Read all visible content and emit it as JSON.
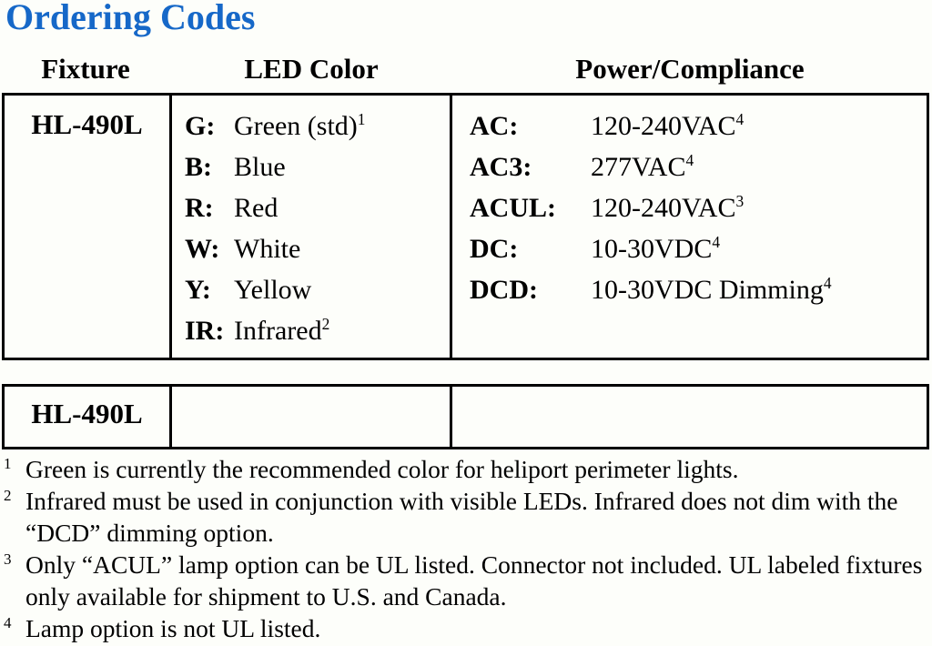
{
  "title": "Ordering Codes",
  "accent_color": "#1668c8",
  "background_color": "#fdfefa",
  "headers": {
    "fixture": "Fixture",
    "led_color": "LED Color",
    "power_compliance": "Power/Compliance"
  },
  "main_table": {
    "fixture": "HL-490L",
    "led_colors": [
      {
        "code": "G:",
        "value": "Green (std)",
        "footnote": "1"
      },
      {
        "code": "B:",
        "value": "Blue",
        "footnote": ""
      },
      {
        "code": "R:",
        "value": "Red",
        "footnote": ""
      },
      {
        "code": "W:",
        "value": "White",
        "footnote": ""
      },
      {
        "code": "Y:",
        "value": "Yellow",
        "footnote": ""
      },
      {
        "code": "IR:",
        "value": "Infrared",
        "footnote": "2"
      }
    ],
    "power_options": [
      {
        "code": "AC:",
        "value": "120-240VAC",
        "footnote": "4"
      },
      {
        "code": "AC3:",
        "value": "277VAC",
        "footnote": "4"
      },
      {
        "code": "ACUL:",
        "value": "120-240VAC",
        "footnote": "3"
      },
      {
        "code": "DC:",
        "value": "10-30VDC",
        "footnote": "4"
      },
      {
        "code": "DCD:",
        "value": "10-30VDC Dimming",
        "footnote": "4"
      }
    ]
  },
  "entry_table": {
    "fixture": "HL-490L",
    "led_color": "",
    "power_compliance": ""
  },
  "footnotes": [
    {
      "marker": "1",
      "text": "Green is currently the recommended color for heliport perimeter lights."
    },
    {
      "marker": "2",
      "text": "Infrared must be used in conjunction with visible LEDs. Infrared does not dim with the “DCD” dimming option."
    },
    {
      "marker": "3",
      "text": "Only “ACUL” lamp option can be UL listed. Connector not included. UL labeled fixtures only available for shipment to U.S. and Canada."
    },
    {
      "marker": "4",
      "text": "Lamp option is not UL listed."
    }
  ]
}
